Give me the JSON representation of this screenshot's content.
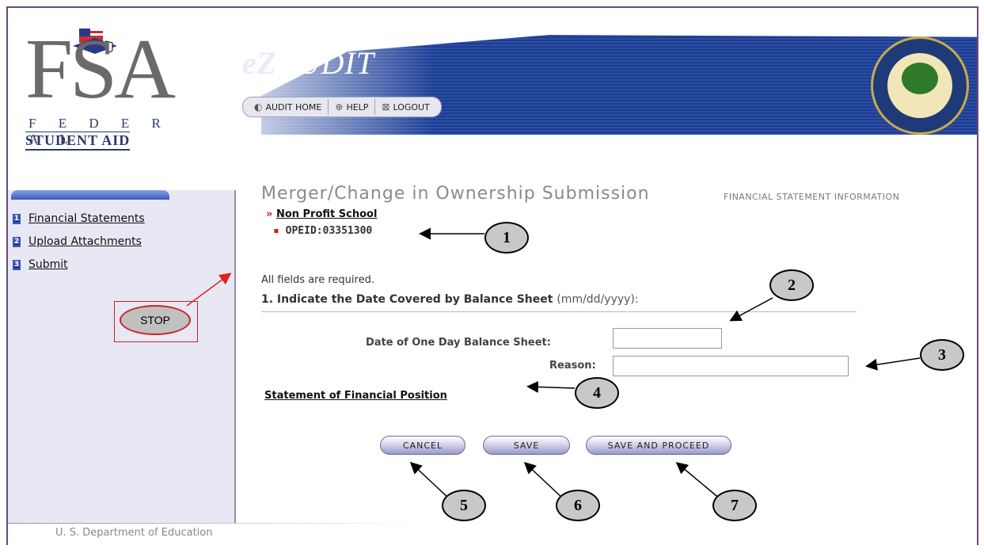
{
  "header": {
    "logo_letters": "FSA",
    "logo_line1": "F E D E R A L",
    "logo_line2": "STUDENT AID",
    "app_name": "AUDIT",
    "app_prefix": "eZ",
    "nav": [
      {
        "label": "AUDIT HOME",
        "icon": "ez-icon"
      },
      {
        "label": "HELP",
        "icon": "help-icon"
      },
      {
        "label": "LOGOUT",
        "icon": "logout-icon"
      }
    ]
  },
  "sidebar": {
    "items": [
      {
        "number": "1",
        "label": "Financial Statements"
      },
      {
        "number": "2",
        "label": "Upload Attachments"
      },
      {
        "number": "3",
        "label": "Submit"
      }
    ],
    "stop_label": "STOP"
  },
  "main": {
    "title": "Merger/Change in Ownership Submission",
    "subtitle": "FINANCIAL STATEMENT INFORMATION",
    "school_marker": "»",
    "school_name": "Non Profit School",
    "opeid_marker": "▪",
    "opeid": "OPEID:03351300",
    "required_note": "All fields are required.",
    "question1": "1. Indicate the Date Covered by Balance Sheet",
    "question1_hint": "(mm/dd/yyyy):",
    "field1_label": "Date of One Day Balance Sheet:",
    "field1_value": "",
    "field2_label": "Reason:",
    "field2_value": "",
    "statement_link": "Statement of Financial Position",
    "buttons": {
      "cancel": "CANCEL",
      "save": "SAVE",
      "save_proceed": "SAVE AND PROCEED"
    }
  },
  "footer": {
    "text": "U. S. Department of Education"
  },
  "callouts": [
    "1",
    "2",
    "3",
    "4",
    "5",
    "6",
    "7"
  ],
  "colors": {
    "accent_red": "#cc2222",
    "banner_blue": "#1e3c8c",
    "sidebar_bg": "#e8e8f4"
  }
}
